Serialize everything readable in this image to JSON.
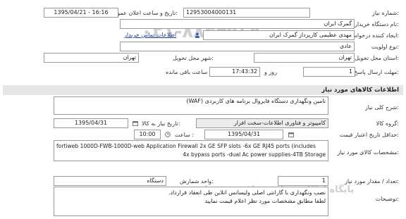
{
  "header": {
    "need_number_label": "شماره نیاز:",
    "need_number": "12953004000131",
    "announce_label": "تاریخ و ساعت اعلان عمومی:",
    "announce_value": "1395/04/21 - 16:16",
    "buyer_name_label": "نام دستگاه خریدار:",
    "buyer_name": "گمرک ایران",
    "creator_label": "ایجاد کننده درخواست:",
    "creator": "مهدی عظیمی کارپرداز گمرک ایران",
    "contact_link": "اطلاعات تماس خریدار",
    "priority_label": "نوع اولویت:",
    "priority": "عادی",
    "province_label": "استان محل تحویل:",
    "province": "تهران",
    "city_label": "شهر محل تحویل:",
    "city": "تهران",
    "deadline_label": "مهلت ارسال پاسخ:",
    "deadline_days": "1",
    "days_word": "روز و",
    "deadline_time": "17:43:32",
    "remaining_word": "ساعت باقی مانده"
  },
  "goods": {
    "section_title": "اطلاعات کالاهای مورد نیاز",
    "summary_label": "شرح کلی نیاز:",
    "summary": "تامین ونگهداری دستگاه فایروال برنامه های کاربردی (WAF)",
    "group_label": "گروه کالا:",
    "group": "کامپیوتر و فناوری اطلاعات-سخت افزار",
    "need_date_label": "تاریخ نیاز به کالا:",
    "need_date": "1395/04/31",
    "validity_label": "حداقل تاریخ اعتبار قیمت:",
    "validity_date": "1395/04/31",
    "time_label": "ساعت :",
    "time_value": "10:00",
    "spec_label": "مشخصات کالای مورد نیاز:",
    "spec_line1": "fortiweb 1000D-FWB-1000D-web Application Firewall 2x GE SFP slots -6x GE RJ45 ports (includes",
    "spec_line2": "4x bypass ports -dual Ac power supplies-4TB Storage",
    "qty_label": "تعداد / مقدار مورد نیاز:",
    "qty": "1",
    "unit_label": "واحد شمارش:",
    "unit": "دستگاه",
    "notes_label": "توضیحات:",
    "note_line1": "نصب ونگهداری با گارانتی اصلی ولیسانس انلاین طی انعقاد قرارداد.",
    "note_line2": "لطفا مطابق مشخصات مورد نظر اعلام قیمت نمایید"
  },
  "watermark": {
    "number": "۰۲۱-۸۸۳۴۹۶۷۰",
    "text": "پایگاه اطلاع رسانی مناقصه و مزایده"
  },
  "icons": {
    "contact": "contact-icon",
    "calendar": "calendar-icon",
    "clock": "clock-icon"
  }
}
